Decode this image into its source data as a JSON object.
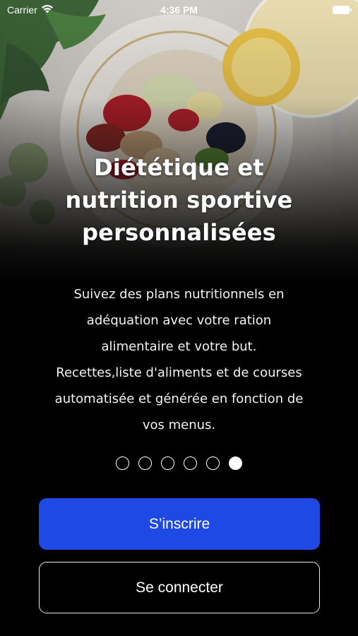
{
  "status_bar": {
    "carrier": "Carrier",
    "time": "4:36 PM",
    "icons": [
      "wifi-icon",
      "battery-icon"
    ]
  },
  "onboarding": {
    "title_lines": [
      "Diététique et",
      "nutrition sportive",
      "personnalisées"
    ],
    "description_lines": [
      "Suivez des plans nutritionnels en",
      "adéquation avec votre ration",
      "alimentaire et votre but.",
      "Recettes,liste d'aliments et de courses",
      "automatisée et générée en fonction de",
      "vos menus."
    ],
    "page_count": 6,
    "active_page": 6
  },
  "actions": {
    "signup_label": "S’inscrire",
    "login_label": "Se connecter"
  },
  "colors": {
    "primary_button": "#1f49e4",
    "background": "#000000"
  }
}
